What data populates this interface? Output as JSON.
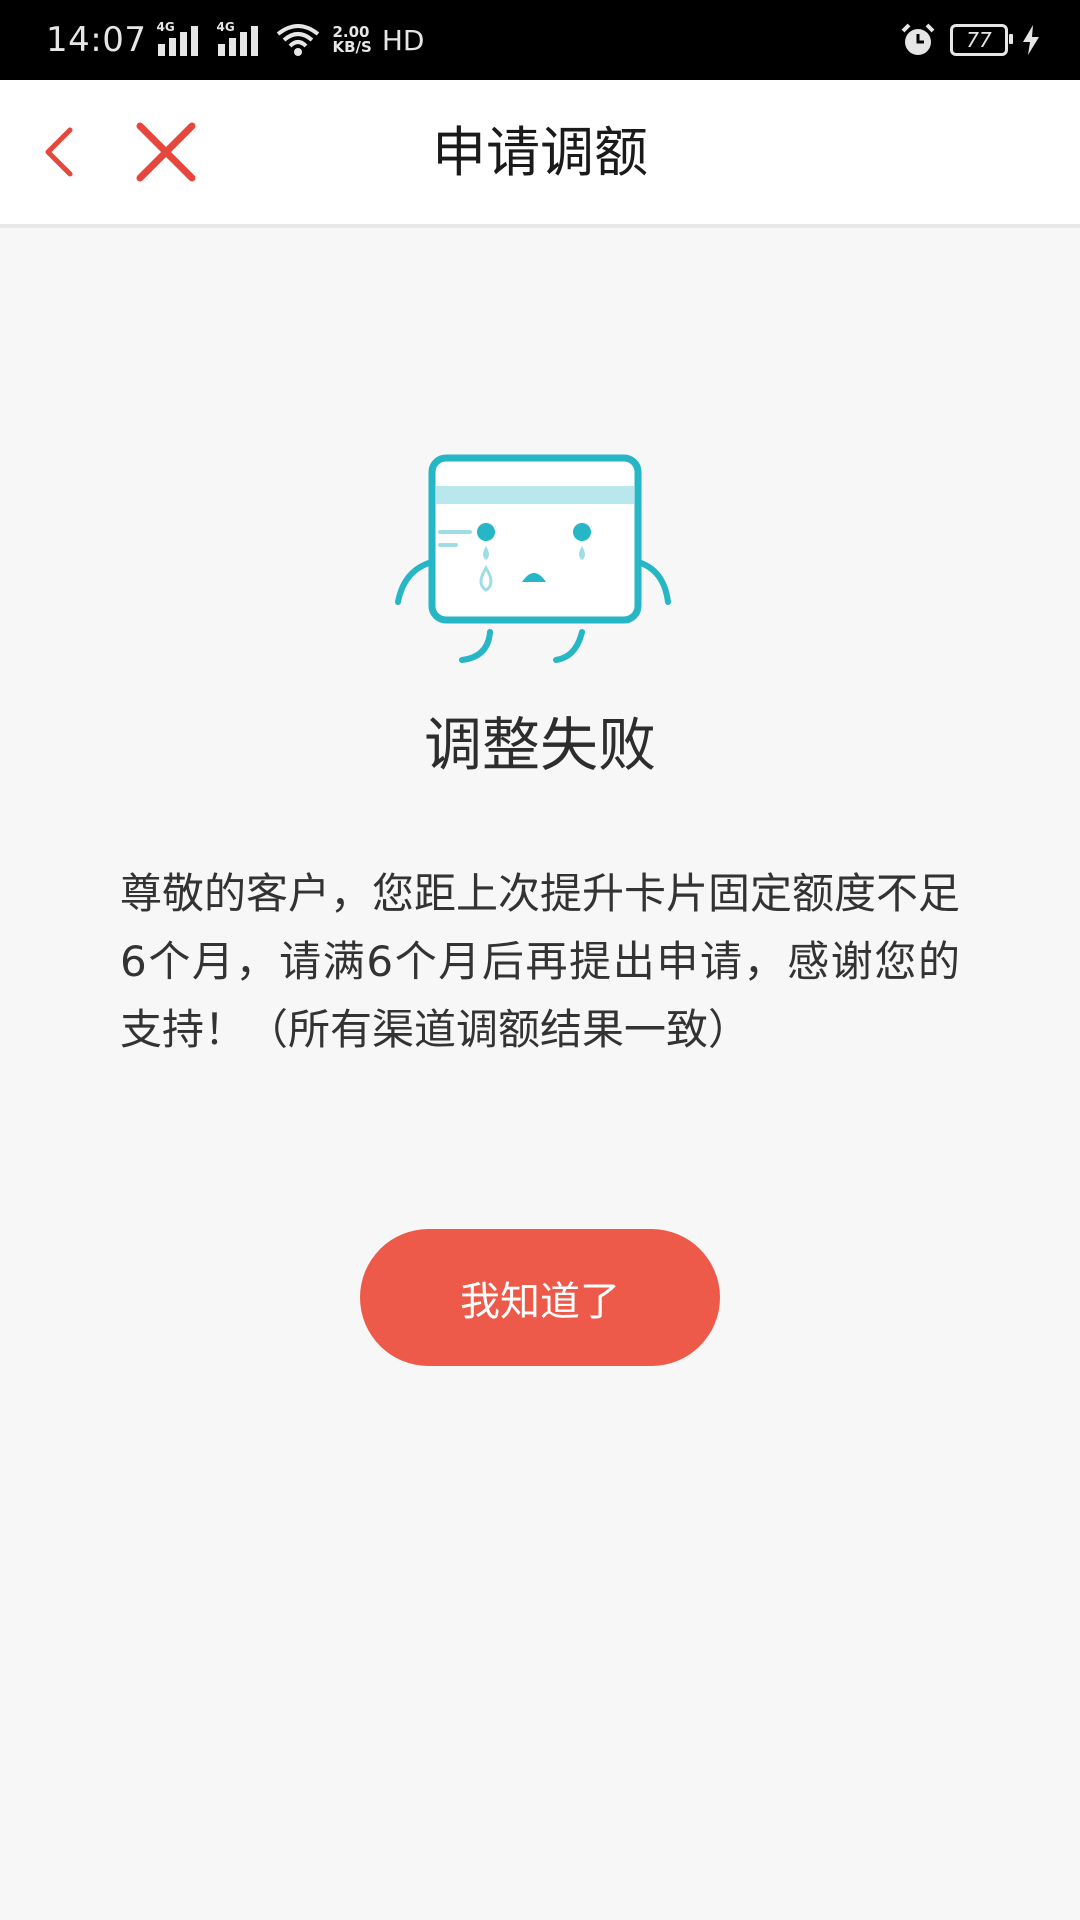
{
  "status_bar": {
    "time": "14:07",
    "network_1": "4G",
    "network_2": "4G",
    "speed_value": "2.00",
    "speed_unit": "KB/S",
    "hd_label": "HD",
    "battery": "77"
  },
  "header": {
    "title": "申请调额",
    "back_icon": "chevron-left",
    "close_icon": "x-mark"
  },
  "result": {
    "icon": "crying-card",
    "title": "调整失败",
    "message": "尊敬的客户，您距上次提升卡片固定额度不足6个月，请满6个月后再提出申请，感谢您的支持！（所有渠道调额结果一致）"
  },
  "actions": {
    "confirm_label": "我知道了"
  },
  "colors": {
    "accent": "#ee5a4a",
    "icon_teal": "#26b6c6",
    "background": "#f7f7f7"
  }
}
